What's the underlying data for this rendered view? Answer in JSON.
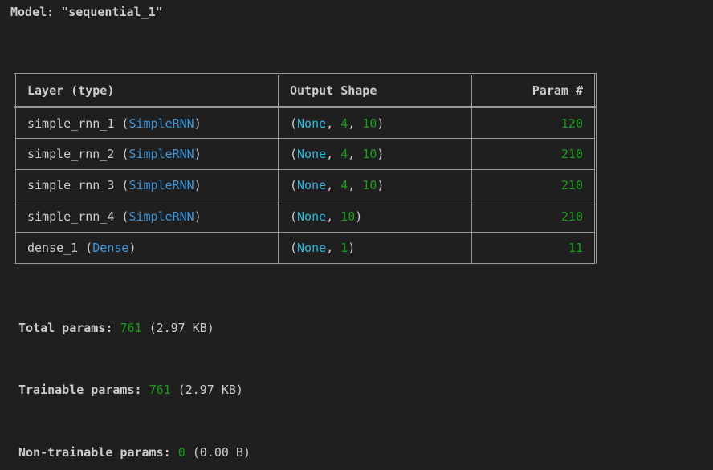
{
  "model": {
    "title": "Model: \"sequential_1\""
  },
  "table": {
    "headers": {
      "layer": "Layer (type)",
      "shape": "Output Shape",
      "param": "Param #"
    },
    "rows": [
      {
        "name": "simple_rnn_1",
        "type": "SimpleRNN",
        "shape": [
          "None",
          "4",
          "10"
        ],
        "params": "120"
      },
      {
        "name": "simple_rnn_2",
        "type": "SimpleRNN",
        "shape": [
          "None",
          "4",
          "10"
        ],
        "params": "210"
      },
      {
        "name": "simple_rnn_3",
        "type": "SimpleRNN",
        "shape": [
          "None",
          "4",
          "10"
        ],
        "params": "210"
      },
      {
        "name": "simple_rnn_4",
        "type": "SimpleRNN",
        "shape": [
          "None",
          "10"
        ],
        "params": "210"
      },
      {
        "name": "dense_1",
        "type": "Dense",
        "shape": [
          "None",
          "1"
        ],
        "params": "11"
      }
    ]
  },
  "stats": {
    "total": {
      "label": "Total params:",
      "value": "761",
      "size": "(2.97 KB)"
    },
    "trainable": {
      "label": "Trainable params:",
      "value": "761",
      "size": "(2.97 KB)"
    },
    "non_trainable": {
      "label": "Non-trainable params:",
      "value": "0",
      "size": "(0.00 B)"
    }
  },
  "colors": {
    "background": "#1f1f1f",
    "text": "#cccccc",
    "type_blue": "#3a96dd",
    "none_cyan": "#29b8db",
    "number_green": "#16a016",
    "border": "#9a9a9a"
  }
}
